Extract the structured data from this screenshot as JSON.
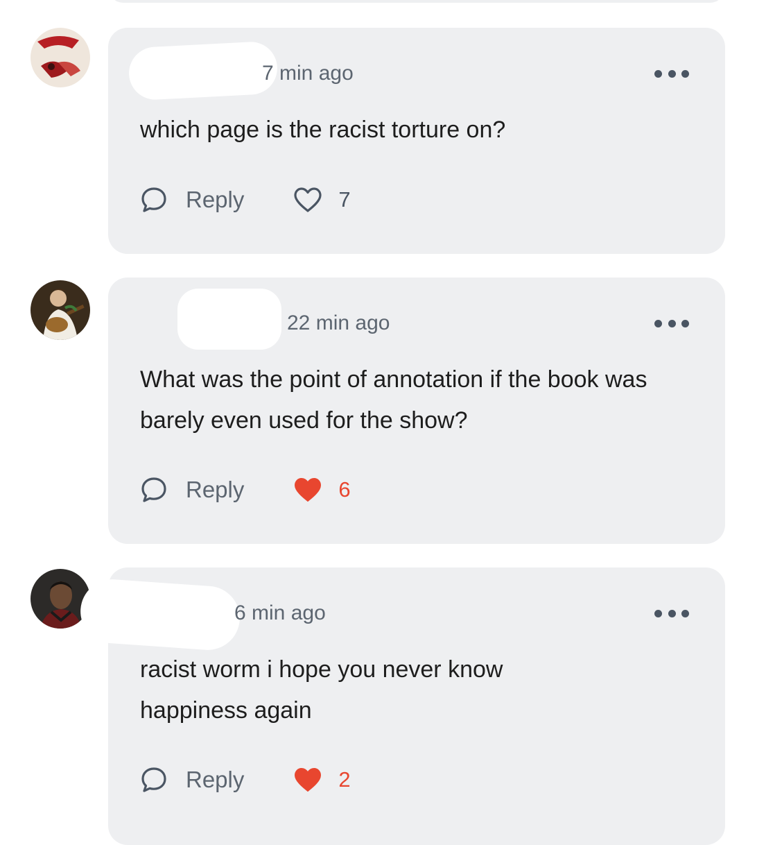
{
  "comments": [
    {
      "time": "​7 min ago",
      "text": "which page is the racist torture on?",
      "reply_label": "Reply",
      "likes": "7",
      "liked": false,
      "avatar": "avatar-red-figure"
    },
    {
      "time": "22 min ago",
      "text": "What was the point of annotation if the book was barely even used for the show?",
      "reply_label": "Reply",
      "likes": "6",
      "liked": true,
      "avatar": "avatar-lute-painting"
    },
    {
      "time": "​6 min ago",
      "text": "racist worm i hope you never know happiness again",
      "reply_label": "Reply",
      "likes": "2",
      "liked": true,
      "avatar": "avatar-man-portrait"
    }
  ],
  "colors": {
    "card_bg": "#eeeff1",
    "muted_text": "#5c6570",
    "liked_red": "#e8462f",
    "icon_gray": "#4a5563"
  },
  "icons": {
    "reply": "speech-bubble-icon",
    "like": "heart-icon",
    "more": "more-dots-icon"
  }
}
